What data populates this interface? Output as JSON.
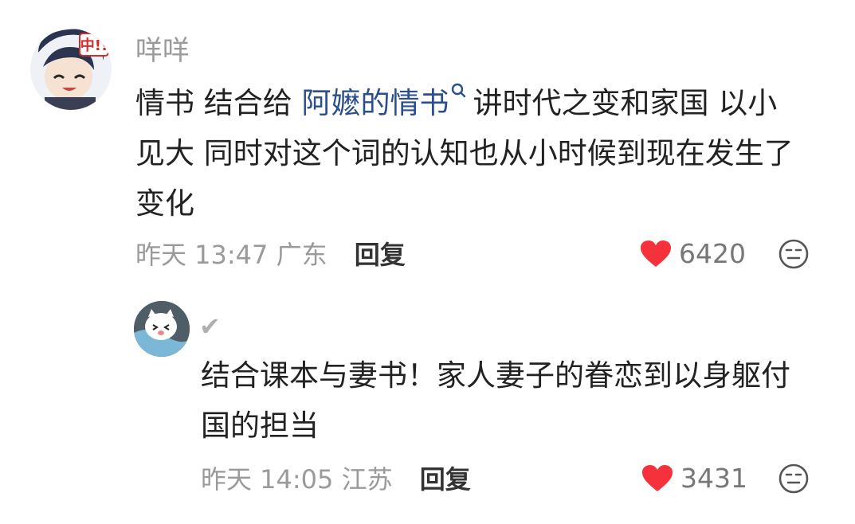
{
  "comments": [
    {
      "username": "咩咩",
      "text_before": "情书 结合给 ",
      "link_text": "阿嬷的情书",
      "text_line1_after": "讲时代之变和家国 以小",
      "text_line2": "见大 同时对这个词的认知也从小时候到现在发生了",
      "text_line3": "变化",
      "time": "昨天 13:47",
      "location": "广东",
      "reply_label": "回复",
      "likes": "6420",
      "avatar_badge": "中!!"
    },
    {
      "username": "✔",
      "text_line1": "结合课本与妻书！家人妻子的眷恋到以身躯付",
      "text_line2": "国的担当",
      "time": "昨天 14:05",
      "location": "江苏",
      "reply_label": "回复",
      "likes": "3431"
    }
  ],
  "colors": {
    "like_heart": "#f5323c",
    "link": "#2b4f8c",
    "meta_text": "#9a9a9a"
  },
  "icons": {
    "like": "heart-icon",
    "emoji": "neutral-face-icon",
    "link_search": "search-icon"
  }
}
